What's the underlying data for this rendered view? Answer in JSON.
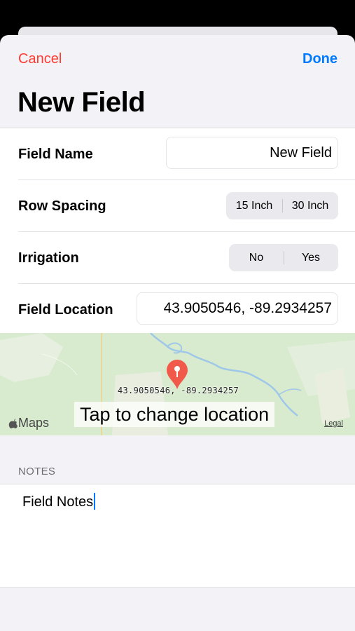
{
  "nav": {
    "cancel_label": "Cancel",
    "done_label": "Done",
    "title": "New Field"
  },
  "form": {
    "field_name": {
      "label": "Field Name",
      "value": "New Field"
    },
    "row_spacing": {
      "label": "Row Spacing",
      "options": [
        "15 Inch",
        "30 Inch"
      ]
    },
    "irrigation": {
      "label": "Irrigation",
      "options": [
        "No",
        "Yes"
      ]
    },
    "field_location": {
      "label": "Field Location",
      "value": "43.9050546, -89.2934257"
    }
  },
  "map": {
    "pin_label": "43.9050546, -89.2934257",
    "tap_label": "Tap to change location",
    "brand": "Maps",
    "legal": "Legal",
    "pin_color": "#f15a4a",
    "land_color": "#d9ebcf",
    "water_color": "#9fc7e8"
  },
  "notes": {
    "header": "NOTES",
    "text": "Field Notes"
  },
  "colors": {
    "accent": "#007aff",
    "destructive": "#ff3b30",
    "background": "#f2f2f7"
  }
}
